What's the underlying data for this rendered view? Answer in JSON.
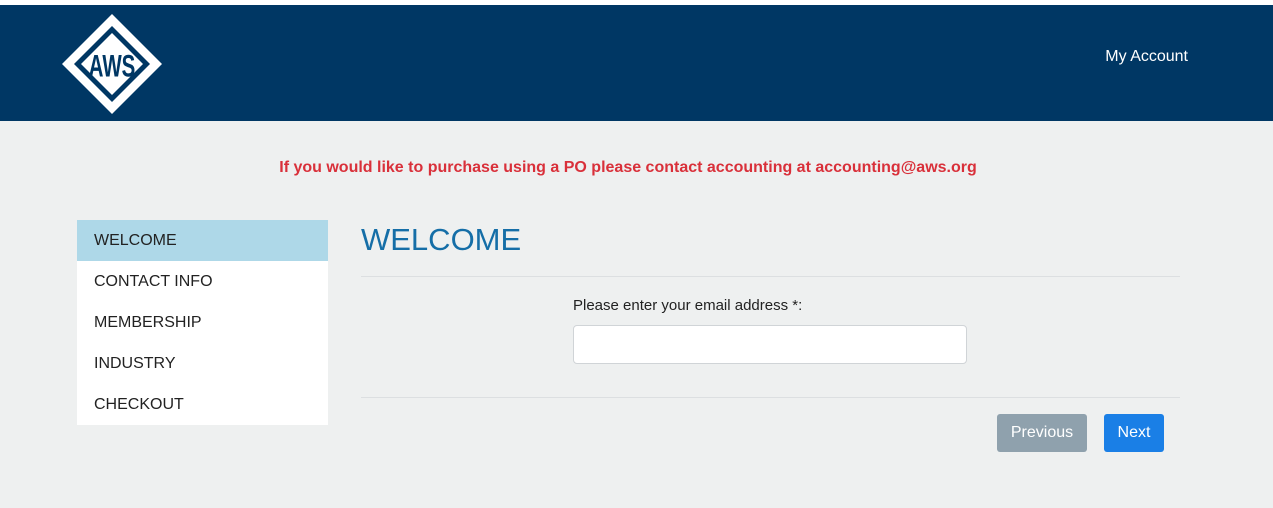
{
  "header": {
    "logo_text": "AWS",
    "my_account_label": "My Account"
  },
  "notice": {
    "text": "If you would like to purchase using a PO please contact accounting at accounting@aws.org"
  },
  "sidebar": {
    "items": [
      {
        "label": "WELCOME",
        "active": true
      },
      {
        "label": "CONTACT INFO",
        "active": false
      },
      {
        "label": "MEMBERSHIP",
        "active": false
      },
      {
        "label": "INDUSTRY",
        "active": false
      },
      {
        "label": "CHECKOUT",
        "active": false
      }
    ]
  },
  "main": {
    "title": "WELCOME",
    "email_label": "Please enter your email address *:",
    "email_value": "",
    "email_placeholder": ""
  },
  "buttons": {
    "previous_label": "Previous",
    "next_label": "Next"
  },
  "colors": {
    "header_bg": "#003764",
    "notice_red": "#d9303a",
    "title_blue": "#156ea7",
    "active_item_bg": "#aed8e8",
    "next_button": "#1a7fe6",
    "previous_button": "#8fa1ad"
  }
}
